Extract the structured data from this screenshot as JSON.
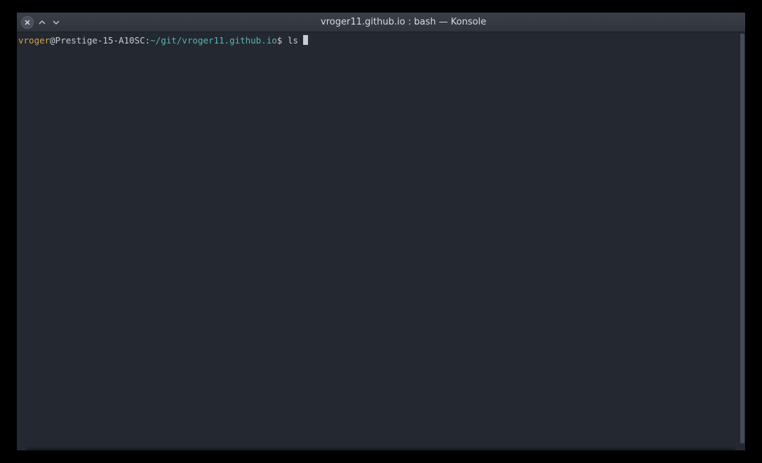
{
  "window": {
    "title": "vroger11.github.io : bash — Konsole"
  },
  "prompt": {
    "user": "vroger",
    "at_host": "@Prestige-15-A10SC:",
    "path": "~/git/vroger11.github.io",
    "symbol": "$",
    "command": "ls "
  },
  "colors": {
    "user": "#d7a04a",
    "path": "#5fb3b3",
    "text": "#c8cdd5",
    "bg": "#232831"
  }
}
